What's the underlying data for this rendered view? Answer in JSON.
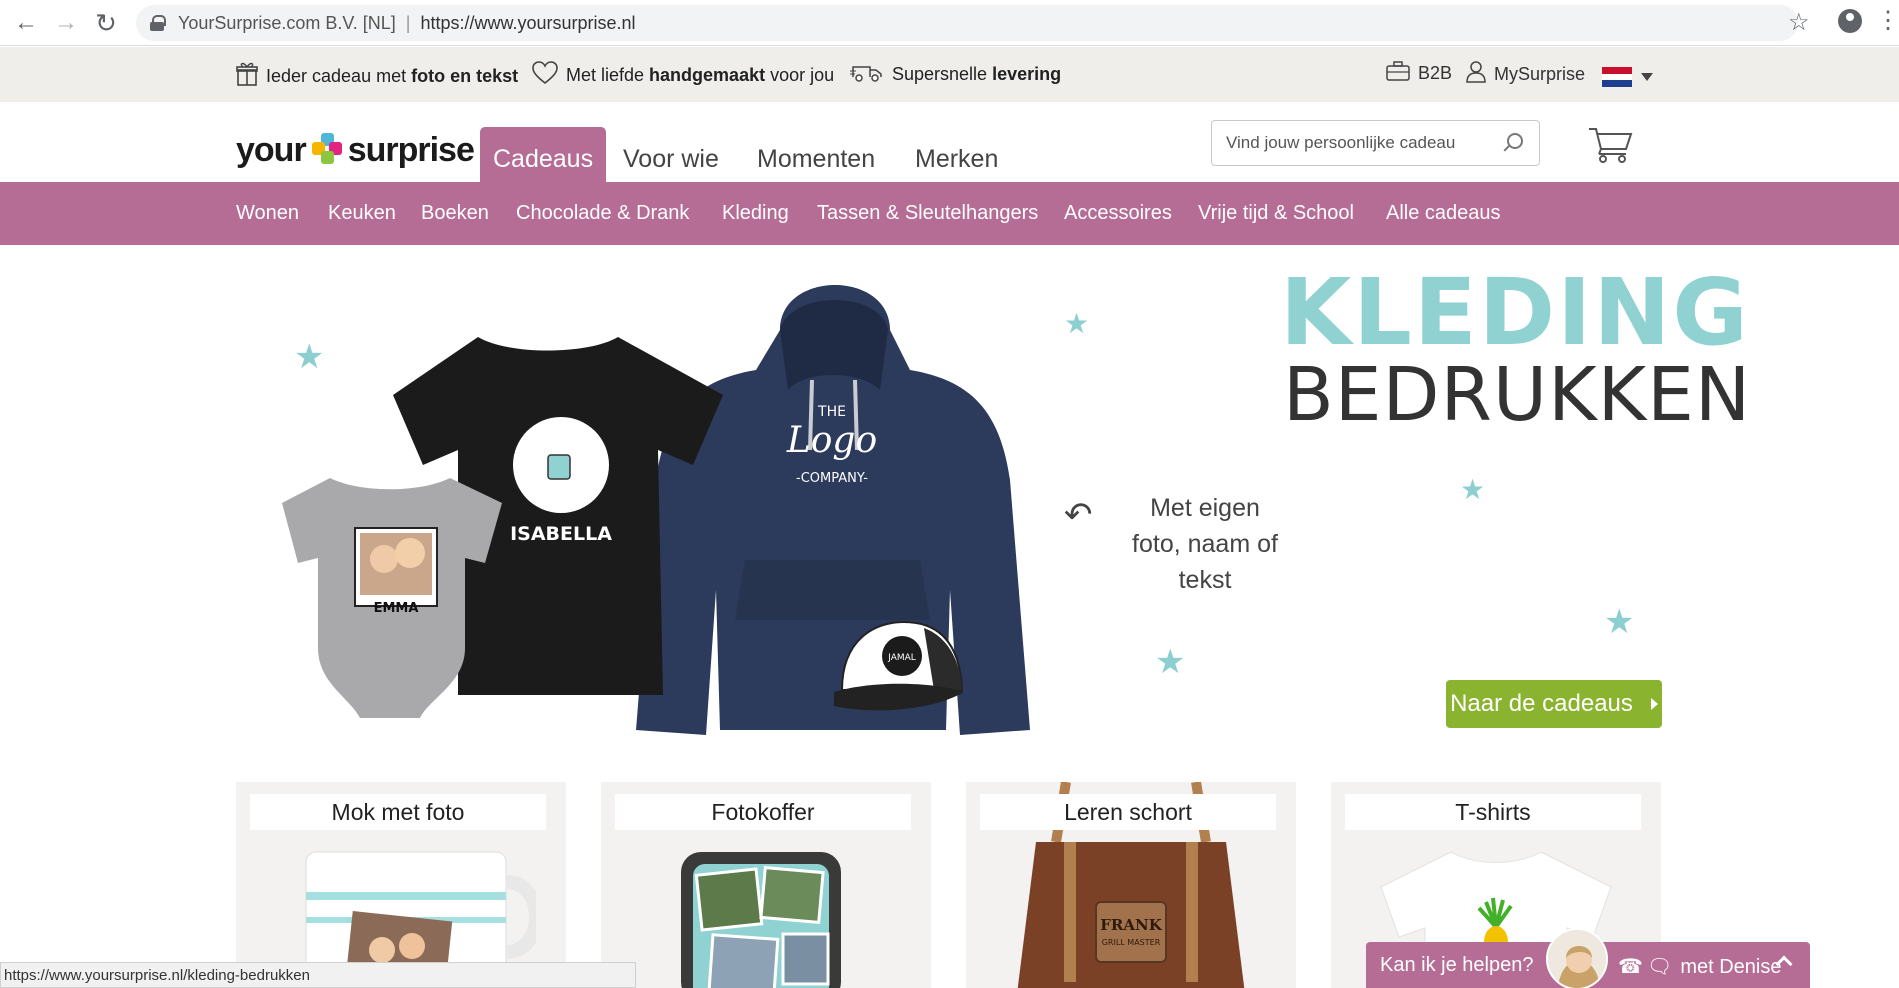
{
  "browser": {
    "org": "YourSurprise.com B.V. [NL]",
    "url": "https://www.yoursurprise.nl",
    "status_url": "https://www.yoursurprise.nl/kleding-bedrukken"
  },
  "usp": {
    "item1_pre": "Ieder cadeau met ",
    "item1_bold": "foto en tekst",
    "item2_pre": "Met liefde ",
    "item2_bold": "handgemaakt",
    "item2_post": " voor jou",
    "item3_pre": "Supersnelle ",
    "item3_bold": "levering"
  },
  "utility": {
    "b2b": "B2B",
    "mysurprise": "MySurprise"
  },
  "header": {
    "logo_left": "your",
    "logo_right": "surprise",
    "tabs": [
      "Cadeaus",
      "Voor wie",
      "Momenten",
      "Merken"
    ],
    "search_placeholder": "Vind jouw persoonlijke cadeau"
  },
  "categories": [
    "Wonen",
    "Keuken",
    "Boeken",
    "Chocolade & Drank",
    "Kleding",
    "Tassen & Sleutelhangers",
    "Accessoires",
    "Vrije tijd & School",
    "Alle cadeaus"
  ],
  "hero": {
    "title_line1": "KLEDING",
    "title_line2": "BEDRUKKEN",
    "note": "Met eigen foto, naam of tekst",
    "cta": "Naar de cadeaus",
    "tshirt_name": "ISABELLA",
    "onesie_name": "EMMA",
    "hoodie_the": "THE",
    "hoodie_logo": "Logo",
    "hoodie_company": "-COMPANY-",
    "cap_name": "JAMAL",
    "apron_name": "FRANK",
    "apron_sub": "GRILL MASTER"
  },
  "cards": [
    {
      "label": "Mok met foto"
    },
    {
      "label": "Fotokoffer"
    },
    {
      "label": "Leren schort"
    },
    {
      "label": "T-shirts"
    }
  ],
  "chat": {
    "question": "Kan ik je helpen?",
    "with": "met Denise"
  },
  "colors": {
    "brand_pink": "#b56c95",
    "cta_green": "#8ab430",
    "title_teal": "#8fd2d1"
  }
}
